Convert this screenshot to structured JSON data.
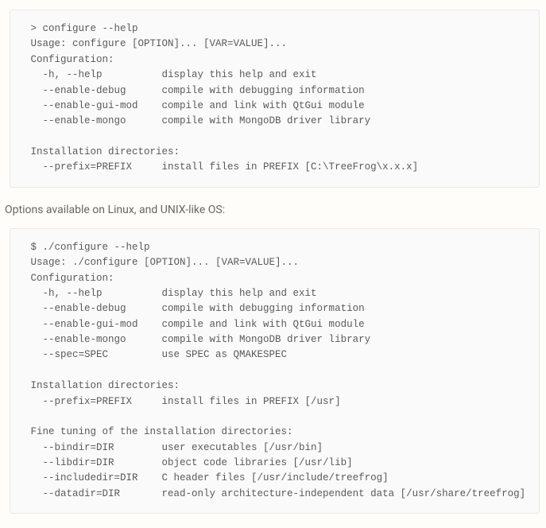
{
  "blocks": {
    "windows": " > configure --help\n Usage: configure [OPTION]... [VAR=VALUE]...\n Configuration:\n   -h, --help          display this help and exit\n   --enable-debug      compile with debugging information\n   --enable-gui-mod    compile and link with QtGui module\n   --enable-mongo      compile with MongoDB driver library\n\n Installation directories:\n   --prefix=PREFIX     install files in PREFIX [C:\\TreeFrog\\x.x.x]",
    "caption": "Options available on Linux, and UNIX-like OS:",
    "unix": " $ ./configure --help\n Usage: ./configure [OPTION]... [VAR=VALUE]...\n Configuration:\n   -h, --help          display this help and exit\n   --enable-debug      compile with debugging information\n   --enable-gui-mod    compile and link with QtGui module\n   --enable-mongo      compile with MongoDB driver library\n   --spec=SPEC         use SPEC as QMAKESPEC\n\n Installation directories:\n   --prefix=PREFIX     install files in PREFIX [/usr]\n\n Fine tuning of the installation directories:\n   --bindir=DIR        user executables [/usr/bin]\n   --libdir=DIR        object code libraries [/usr/lib]\n   --includedir=DIR    C header files [/usr/include/treefrog]\n   --datadir=DIR       read-only architecture-independent data [/usr/share/treefrog]"
  }
}
